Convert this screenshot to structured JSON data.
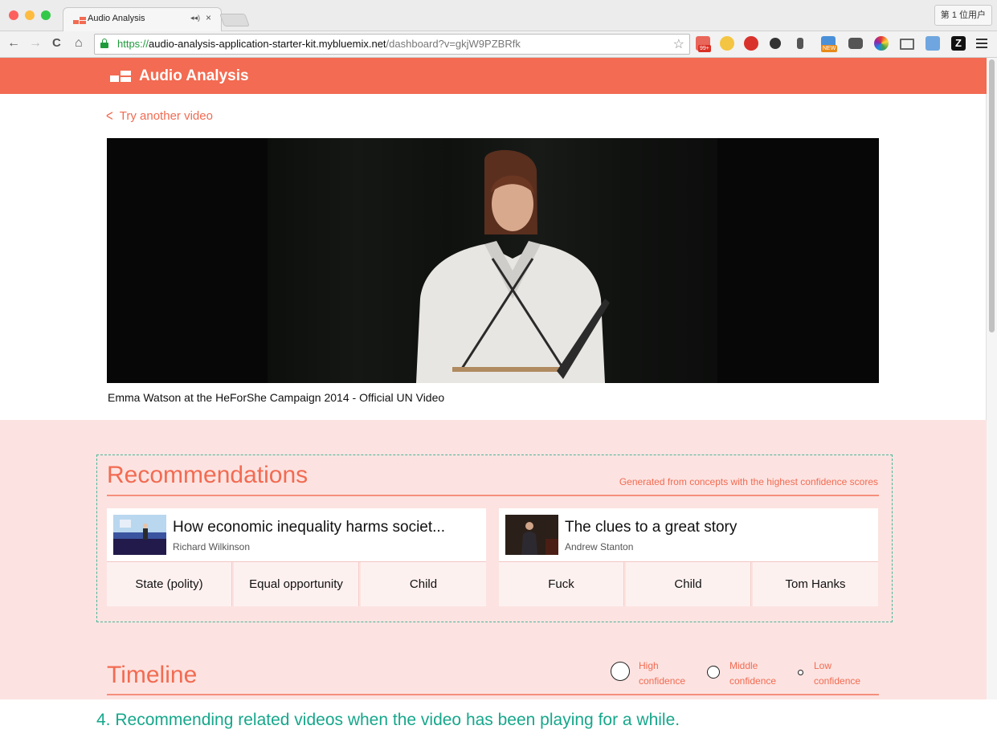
{
  "browser": {
    "tab_title": "Audio Analysis",
    "tab_audio_icon": "◂◂)",
    "tab_close": "×",
    "profile_label": "第 1 位用户",
    "url_scheme": "https://",
    "url_host": "audio-analysis-application-starter-kit.mybluemix.net",
    "url_path": "/dashboard?v=gkjW9PZBRfk",
    "back_glyph": "←",
    "forward_glyph": "→",
    "reload_glyph": "C",
    "home_glyph": "⌂",
    "star_glyph": "☆",
    "ext_badge_99": "99+",
    "ext_badge_new": "NEW",
    "ext_z": "Z"
  },
  "app": {
    "title": "Audio Analysis",
    "back_label": "Try another video",
    "back_glyph": "<",
    "video_caption": "Emma Watson at the HeForShe Campaign 2014 - Official UN Video"
  },
  "recommendations": {
    "title": "Recommendations",
    "subtitle": "Generated from concepts with the highest confidence scores",
    "cards": [
      {
        "title": "How economic inequality harms societ...",
        "author": "Richard Wilkinson",
        "concepts": [
          "State (polity)",
          "Equal opportunity",
          "Child"
        ]
      },
      {
        "title": "The clues to a great story",
        "author": "Andrew Stanton",
        "concepts": [
          "Fuck",
          "Child",
          "Tom Hanks"
        ]
      }
    ]
  },
  "timeline": {
    "title": "Timeline",
    "legend": [
      {
        "line1": "High",
        "line2": "confidence"
      },
      {
        "line1": "Middle",
        "line2": "confidence"
      },
      {
        "line1": "Low",
        "line2": "confidence"
      }
    ]
  },
  "footnote": "4. Recommending related videos when the video has been playing for a while.",
  "colors": {
    "brand": "#f26b52",
    "panel": "#fce3e1",
    "dashed": "#4bb49a",
    "footnote": "#16a78b"
  }
}
